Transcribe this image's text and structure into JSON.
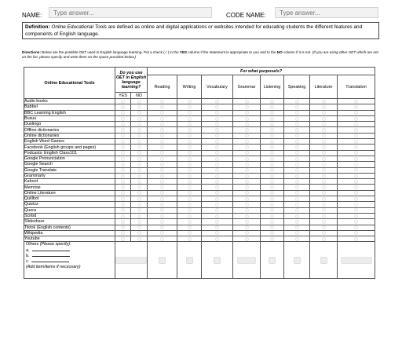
{
  "header": {
    "name_label": "NAME:",
    "name_placeholder": "Type answer...",
    "code_label": "CODE NAME:",
    "code_placeholder": "Type answer..."
  },
  "definition": {
    "term": "Definition:",
    "term_italic": "Online Educational Tools",
    "text": "are defined as online and digital applications or websites intended for educating students the different features and components of English language."
  },
  "directions": {
    "lead": "Directions:",
    "text1": "Below are the possible OET used in English language learning. Put a check (✓) in the",
    "yes": "YES",
    "text2": "column if the statement is appropriate to you and to the",
    "no": "NO",
    "text3": "column if it is not.",
    "italic": "(If you are using other OET which are not on the list, please specify and write them on the space provided below.)"
  },
  "table": {
    "col_tools": "Online Educational Tools",
    "col_use": "Do you use OET in English language learning?",
    "col_purpose": "For what purpose/s?",
    "yes": "YES",
    "no": "NO",
    "categories": [
      "Reading",
      "Writing",
      "Vocabulary",
      "Grammar",
      "Listening",
      "Speaking",
      "Literature",
      "Translation"
    ],
    "tools": [
      "Audio books",
      "Babbel",
      "BBC Learning English",
      "Busuu",
      "Duolingo",
      "Offline dictionaries",
      "Online dictionaries",
      "English Word Games",
      "Facebook (English groups and pages)",
      "Podcasts: English Class101",
      "Google Pronunciation",
      "Google Search",
      "Google Translate",
      "Grammarly",
      "Kahoot",
      "Memrise",
      "Online Literature",
      "Quillbot",
      "Quizizz",
      "Quora",
      "Scribd",
      "Slideshare",
      "Tiktok (English contents)",
      "Wikipedia",
      "Youtube"
    ],
    "others_label": "Others",
    "others_hint": "(Please specify):",
    "others_a": "a.",
    "others_b": "b.",
    "others_c": "c.",
    "others_add": "(Add item/items if necessary)"
  }
}
